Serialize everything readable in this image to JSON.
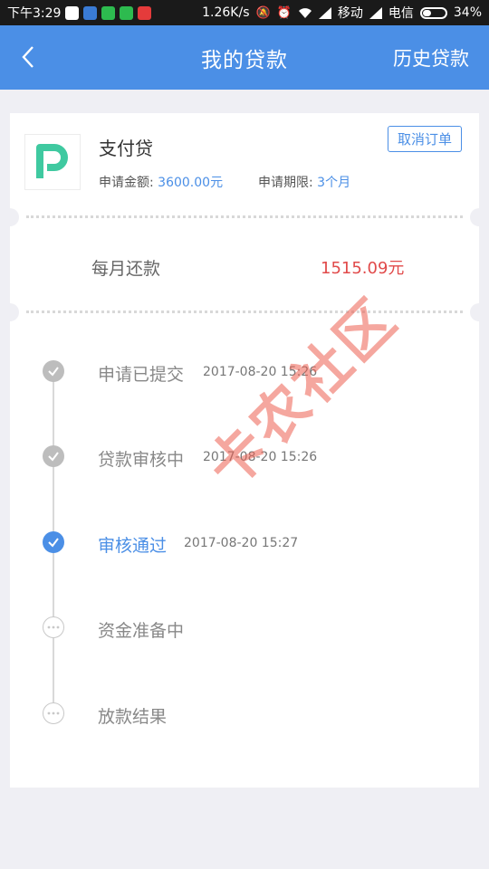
{
  "status_bar": {
    "time": "下午3:29",
    "speed": "1.26K/s",
    "carrier1": "移动",
    "carrier2": "电信",
    "battery": "34%",
    "battery_level": 0.34
  },
  "navbar": {
    "title": "我的贷款",
    "history": "历史贷款"
  },
  "loan": {
    "name": "支付贷",
    "cancel_label": "取消订单",
    "amount_label": "申请金额:",
    "amount_value": "3600.00元",
    "term_label": "申请期限:",
    "term_value": "3个月",
    "monthly_label": "每月还款",
    "monthly_value": "1515.09元"
  },
  "steps": [
    {
      "label": "申请已提交",
      "time": "2017-08-20 15:26",
      "state": "done"
    },
    {
      "label": "贷款审核中",
      "time": "2017-08-20 15:26",
      "state": "done"
    },
    {
      "label": "审核通过",
      "time": "2017-08-20 15:27",
      "state": "active"
    },
    {
      "label": "资金准备中",
      "time": "",
      "state": "pending"
    },
    {
      "label": "放款结果",
      "time": "",
      "state": "pending"
    }
  ],
  "watermark": "卡农社区",
  "colors": {
    "accent": "#4b8fe6",
    "danger": "#e14a4a",
    "logo": "#3fc9a0"
  }
}
